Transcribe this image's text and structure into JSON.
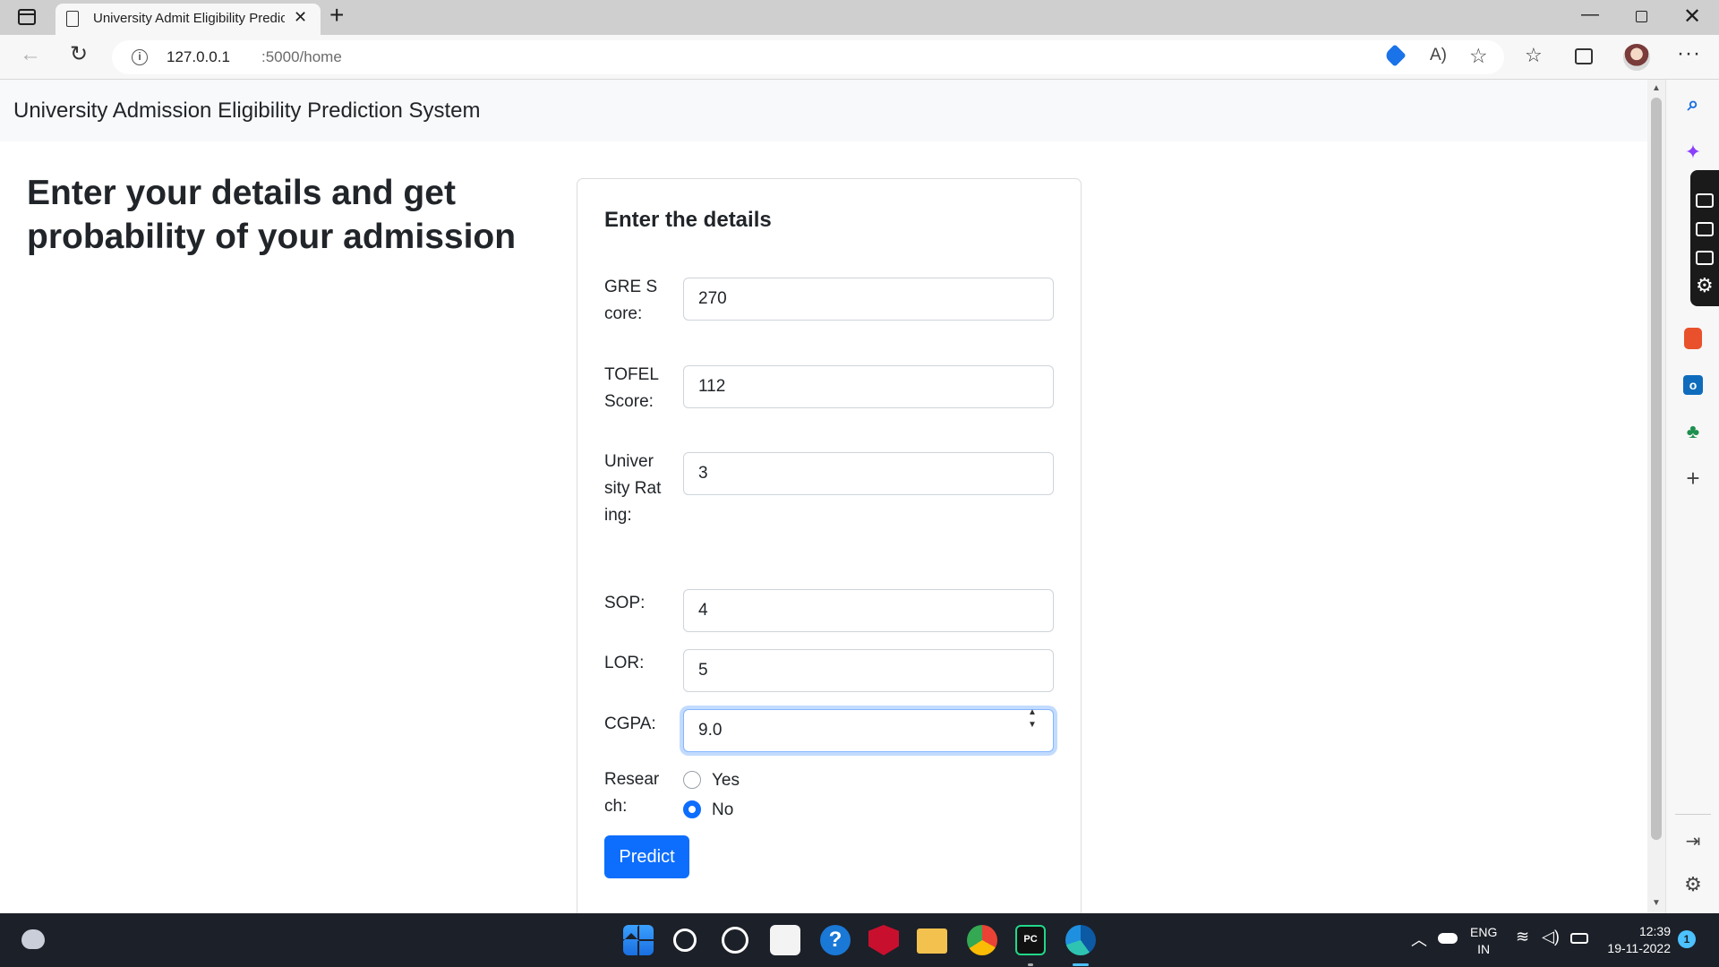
{
  "browser": {
    "tab_title": "University Admit Eligibility Predic",
    "url_host": "127.0.0.1",
    "url_path": ":5000/home"
  },
  "page": {
    "brand": "University Admission Eligibility Prediction System",
    "heading": "Enter your details and get probability of your admission",
    "card_title": "Enter the details",
    "fields": [
      {
        "label": "GRE Score:",
        "value": "270"
      },
      {
        "label": "TOFEL Score:",
        "value": "112"
      },
      {
        "label": "University Rating:",
        "value": "3"
      },
      {
        "label": "SOP:",
        "value": "4"
      },
      {
        "label": "LOR:",
        "value": "5"
      },
      {
        "label": "CGPA:",
        "value": "9.0"
      }
    ],
    "research": {
      "label": "Research:",
      "options": [
        {
          "label": "Yes",
          "checked": false
        },
        {
          "label": "No",
          "checked": true
        }
      ]
    },
    "predict_label": "Predict"
  },
  "taskbar": {
    "lang_line1": "ENG",
    "lang_line2": "IN",
    "time": "12:39",
    "date": "19-11-2022",
    "notification_count": "1"
  },
  "colors": {
    "primary": "#0d6efd",
    "navbar_bg": "#f8f9fa",
    "taskbar_bg": "#1c2029"
  },
  "icons": [
    "tab-actions-icon",
    "page-icon",
    "close-icon",
    "new-tab-icon",
    "minimize-icon",
    "maximize-icon",
    "window-close-icon",
    "back-icon",
    "reload-icon",
    "info-icon",
    "price-tag-icon",
    "read-aloud-icon",
    "add-favorite-icon",
    "favorites-icon",
    "collections-icon",
    "more-icon",
    "search-icon",
    "copilot-icon",
    "office-icon",
    "outlook-icon",
    "tree-icon",
    "add-icon",
    "panel-icon",
    "gear-icon"
  ]
}
